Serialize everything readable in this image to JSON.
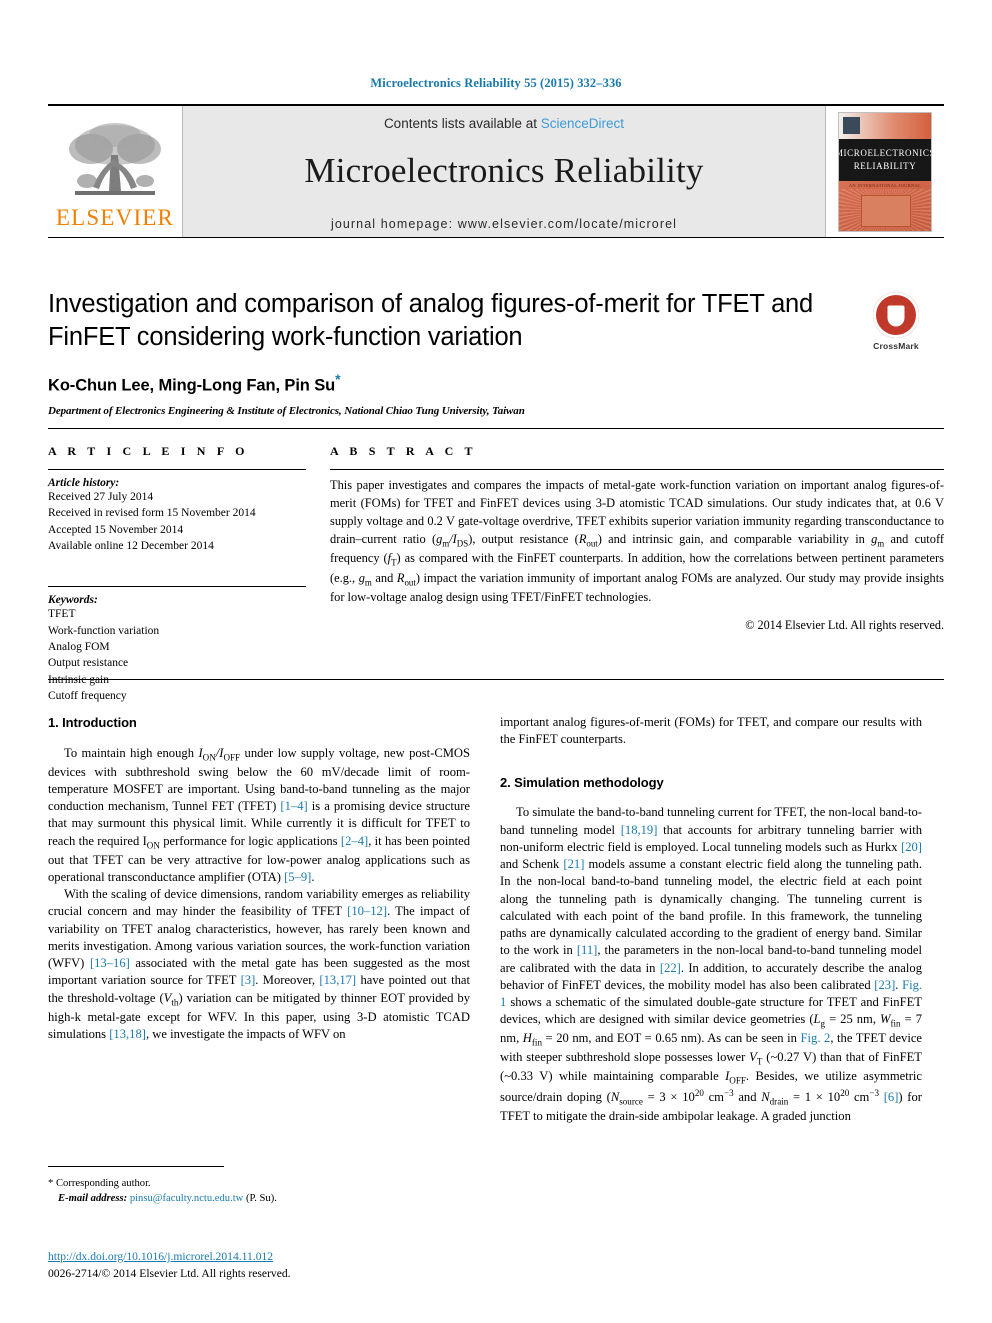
{
  "running_head": "Microelectronics Reliability 55 (2015) 332–336",
  "masthead": {
    "contents_prefix": "Contents lists available at ",
    "sciencedirect": "ScienceDirect",
    "journal_title": "Microelectronics Reliability",
    "homepage": "journal homepage: www.elsevier.com/locate/microrel",
    "publisher_name": "ELSEVIER",
    "cover_title_line1": "MICROELECTRONICS",
    "cover_title_line2": "RELIABILITY",
    "cover_subtitle": "AN INTERNATIONAL JOURNAL"
  },
  "colors": {
    "link_blue": "#1a7aad",
    "sciencedirect_blue": "#3b9ad9",
    "elsevier_orange": "#f08000",
    "crossmark_red": "#c0392b",
    "masthead_gray": "#e8e8e8"
  },
  "article": {
    "title": "Investigation and comparison of analog figures-of-merit for TFET and FinFET considering work-function variation",
    "authors": "Ko-Chun Lee, Ming-Long Fan, Pin Su",
    "corresponding_marker": "*",
    "affiliation": "Department of Electronics Engineering & Institute of Electronics, National Chiao Tung University, Taiwan"
  },
  "crossmark": {
    "label": "CrossMark"
  },
  "info": {
    "heading": "A R T I C L E   I N F O",
    "history_label": "Article history:",
    "history": [
      "Received 27 July 2014",
      "Received in revised form 15 November 2014",
      "Accepted 15 November 2014",
      "Available online 12 December 2014"
    ],
    "keywords_label": "Keywords:",
    "keywords": [
      "TFET",
      "Work-function variation",
      "Analog FOM",
      "Output resistance",
      "Intrinsic gain",
      "Cutoff frequency"
    ]
  },
  "abstract": {
    "heading": "A B S T R A C T",
    "p1_a": "This paper investigates and compares the impacts of metal-gate work-function variation on important analog figures-of-merit (FOMs) for TFET and FinFET devices using 3-D atomistic TCAD simulations. Our study indicates that, at 0.6 V supply voltage and 0.2 V gate-voltage overdrive, TFET exhibits superior variation immunity regarding transconductance to drain–current ratio (",
    "gm_over_ids": "g",
    "gm_sub": "m",
    "ids_sep": "/I",
    "ids_sub": "DS",
    "p1_b": "), output resistance (",
    "rout": "R",
    "rout_sub": "out",
    "p1_c": ") and intrinsic gain, and comparable variability in ",
    "gm2": "g",
    "gm2_sub": "m",
    "p1_d": " and cutoff frequency (",
    "ft": "f",
    "ft_sub": "T",
    "p1_e": ") as compared with the FinFET counterparts. In addition, how the correlations between pertinent parameters (e.g., ",
    "gm3": "g",
    "gm3_sub": "m",
    "p1_f": " and ",
    "rout2": "R",
    "rout2_sub": "out",
    "p1_g": ") impact the variation immunity of important analog FOMs are analyzed. Our study may provide insights for low-voltage analog design using TFET/FinFET technologies.",
    "copyright": "© 2014 Elsevier Ltd. All rights reserved."
  },
  "sections": {
    "intro_heading": "1. Introduction",
    "sim_heading": "2. Simulation methodology"
  },
  "left_column": {
    "p1_a": "To maintain high enough ",
    "p1_ion": "I",
    "p1_ion_sub": "ON",
    "p1_slash": "/I",
    "p1_ioff_sub": "OFF",
    "p1_b": " under low supply voltage, new post-CMOS devices with subthreshold swing below the 60 mV/decade limit of room-temperature MOSFET are important. Using band-to-band tunneling as the major conduction mechanism, Tunnel FET (TFET) ",
    "ref_1_4": "[1–4]",
    "p1_c": " is a promising device structure that may surmount this physical limit. While currently it is difficult for TFET to reach the required I",
    "p1_ion2_sub": "ON",
    "p1_d": " performance for logic applications ",
    "ref_2_4": "[2–4]",
    "p1_e": ", it has been pointed out that TFET can be very attractive for low-power analog applications such as operational transconductance amplifier (OTA) ",
    "ref_5_9": "[5–9]",
    "p1_f": ".",
    "p2_a": "With the scaling of device dimensions, random variability emerges as reliability crucial concern and may hinder the feasibility of TFET ",
    "ref_10_12": "[10–12]",
    "p2_b": ". The impact of variability on TFET analog characteristics, however, has rarely been known and merits investigation. Among various variation sources, the work-function variation (WFV) ",
    "ref_13_16": "[13–16]",
    "p2_c": " associated with the metal gate has been suggested as the most important variation source for TFET ",
    "ref_3": "[3]",
    "p2_d": ". Moreover, ",
    "ref_13_17": "[13,17]",
    "p2_e": " have pointed out that the threshold-voltage (",
    "vth": "V",
    "vth_sub": "th",
    "p2_f": ") variation can be mitigated by thinner EOT provided by high-k metal-gate except for WFV. In this paper, using 3-D atomistic TCAD simulations ",
    "ref_13_18": "[13,18]",
    "p2_g": ", we investigate the impacts of WFV on"
  },
  "right_column": {
    "p0": "important analog figures-of-merit (FOMs) for TFET, and compare our results with the FinFET counterparts.",
    "p1_a": "To simulate the band-to-band tunneling current for TFET, the non-local band-to-band tunneling model ",
    "ref_18_19": "[18,19]",
    "p1_b": " that accounts for arbitrary tunneling barrier with non-uniform electric field is employed. Local tunneling models such as Hurkx ",
    "ref_20": "[20]",
    "p1_c": " and Schenk ",
    "ref_21": "[21]",
    "p1_d": " models assume a constant electric field along the tunneling path. In the non-local band-to-band tunneling model, the electric field at each point along the tunneling path is dynamically changing. The tunneling current is calculated with each point of the band profile. In this framework, the tunneling paths are dynamically calculated according to the gradient of energy band. Similar to the work in ",
    "ref_11": "[11]",
    "p1_e": ", the parameters in the non-local band-to-band tunneling model are calibrated with the data in ",
    "ref_22": "[22]",
    "p1_f": ". In addition, to accurately describe the analog behavior of FinFET devices, the mobility model has also been calibrated ",
    "ref_23": "[23]",
    "p1_g": ". ",
    "fig1": "Fig. 1",
    "p1_h": " shows a schematic of the simulated double-gate structure for TFET and FinFET devices, which are designed with similar device geometries (",
    "lg": "L",
    "lg_sub": "g",
    "lg_val": " = 25 nm, ",
    "wfin": "W",
    "wfin_sub": "fin",
    "wfin_val": " = 7 nm, ",
    "hfin": "H",
    "hfin_sub": "fin",
    "hfin_val": " = 20 nm, and EOT = 0.65 nm). As can be seen in ",
    "fig2": "Fig. 2",
    "p1_i": ", the TFET device with steeper subthreshold slope possesses lower ",
    "vt": "V",
    "vt_sub": "T",
    "p1_j": " (~0.27 V) than that of FinFET (~0.33 V) while maintaining comparable ",
    "ioff": "I",
    "ioff_sub": "OFF",
    "p1_k": ". Besides, we utilize asymmetric source/drain doping (",
    "nsource": "N",
    "nsource_sub": "source",
    "nsource_val": " = 3 × 10",
    "nsource_exp": "20",
    "nsource_unit": " cm",
    "nsource_unit_exp": "−3",
    "p1_l": " and ",
    "ndrain": "N",
    "ndrain_sub": "drain",
    "ndrain_val": " = 1 × 10",
    "ndrain_exp": "20",
    "ndrain_unit": " cm",
    "ndrain_unit_exp": "−3",
    "p1_m": " ",
    "ref_6": "[6]",
    "p1_n": ") for TFET to mitigate the drain-side ambipolar leakage. A graded junction"
  },
  "footnote": {
    "marker": "*",
    "corresponding": "Corresponding author.",
    "email_label": "E-mail address:",
    "email": "pinsu@faculty.nctu.edu.tw",
    "email_suffix": "(P. Su)."
  },
  "footer": {
    "doi": "http://dx.doi.org/10.1016/j.microrel.2014.11.012",
    "issn_line": "0026-2714/© 2014 Elsevier Ltd. All rights reserved."
  }
}
